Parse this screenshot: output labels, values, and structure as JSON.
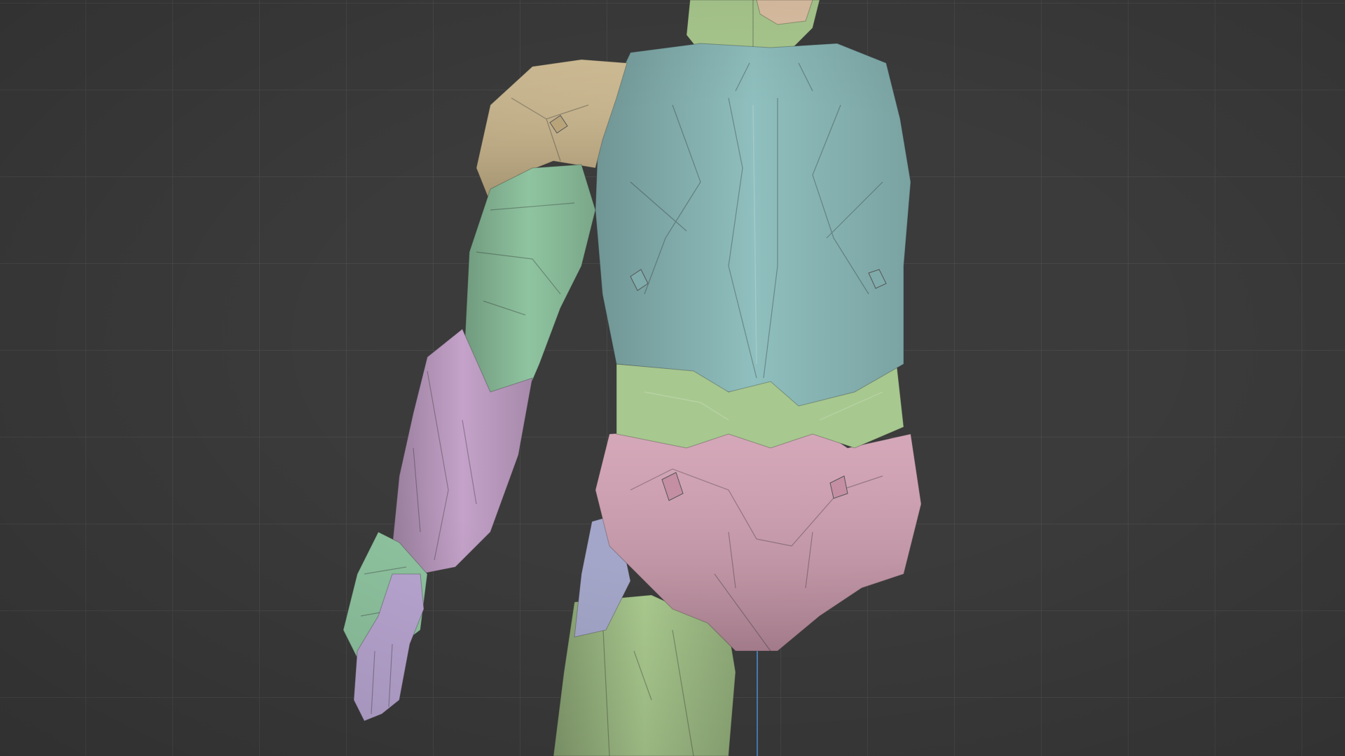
{
  "viewport": {
    "mode": "solid-random-colors",
    "background": "#3b3b3b",
    "grid_color": "#505050",
    "axis_color": "#4a7fb8"
  },
  "model": {
    "parts": {
      "chest": "#8fbfbe",
      "abdomen": "#a7c88f",
      "pelvis": "#d29fb2",
      "shoulder_armor": "#cbb68a",
      "upper_arm": "#8fc4a0",
      "forearm": "#c4a2c9",
      "hand": "#8fc4a0",
      "fingers": "#b9a6d2",
      "thigh": "#a9c98e",
      "inner_thigh": "#a4a6c9",
      "neck": "#a9c98e",
      "head": "#dcc0a3"
    }
  }
}
